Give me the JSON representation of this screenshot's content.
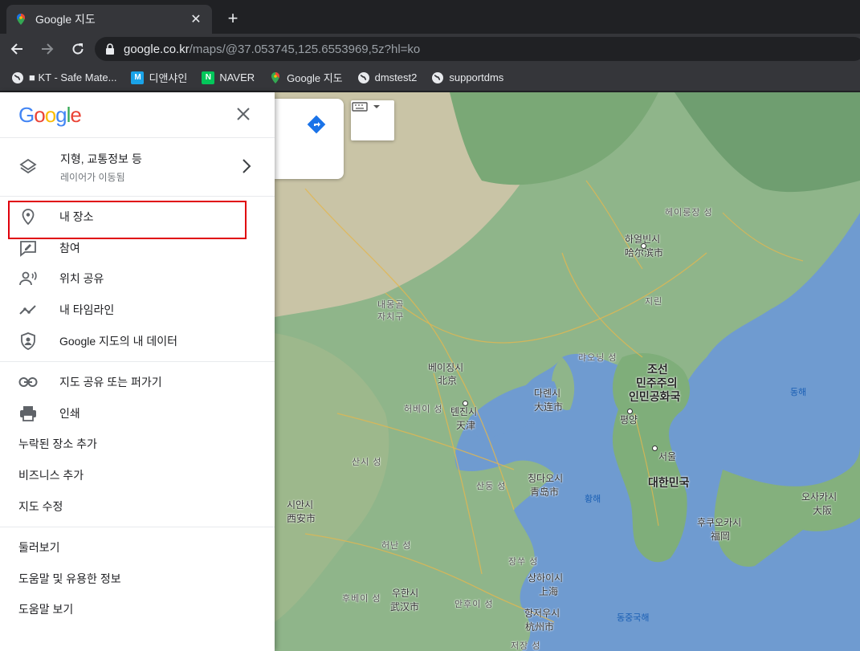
{
  "browser": {
    "tab_title": "Google 지도",
    "url_host": "google.co.kr",
    "url_path": "/maps/@37.053745,125.6553969,5z?hl=ko",
    "bookmarks": [
      {
        "label": "■ KT - Safe Mate...",
        "icon": "globe-icon"
      },
      {
        "label": "디앤샤인",
        "icon": "m-icon",
        "color": "#1aa3e8"
      },
      {
        "label": "NAVER",
        "icon": "naver-icon",
        "color": "#03c75a"
      },
      {
        "label": "Google 지도",
        "icon": "maps-pin-icon"
      },
      {
        "label": "dmstest2",
        "icon": "globe-icon"
      },
      {
        "label": "supportdms",
        "icon": "globe-icon"
      }
    ]
  },
  "panel": {
    "logo": "Google",
    "layers_title": "지형, 교통정보 등",
    "layers_subtitle": "레이어가 이동됨",
    "section1": [
      {
        "label": "내 장소",
        "icon": "pin-icon"
      },
      {
        "label": "참여",
        "icon": "contribute-icon"
      },
      {
        "label": "위치 공유",
        "icon": "location-sharing-icon"
      },
      {
        "label": "내 타임라인",
        "icon": "timeline-icon"
      },
      {
        "label": "Google 지도의 내 데이터",
        "icon": "shield-icon"
      }
    ],
    "section2": [
      {
        "label": "지도 공유 또는 퍼가기",
        "icon": "link-icon"
      },
      {
        "label": "인쇄",
        "icon": "print-icon"
      },
      {
        "label": "누락된 장소 추가"
      },
      {
        "label": "비즈니스 추가"
      },
      {
        "label": "지도 수정"
      }
    ],
    "section3": [
      {
        "label": "둘러보기"
      },
      {
        "label": "도움말 및 유용한 정보"
      },
      {
        "label": "도움말 보기"
      }
    ]
  },
  "map": {
    "labels": {
      "heilongjiang": "헤이룽장 성",
      "harbin_ko": "하얼빈시",
      "harbin_zh": "哈尔滨市",
      "jilin": "지린",
      "neimenggu1": "내몽골",
      "neimenggu2": "자치구",
      "liaoning": "랴오닝 성",
      "beijing_ko": "베이징시",
      "beijing_zh": "北京",
      "tianjin_ko": "톈진시",
      "tianjin_zh": "天津",
      "hebei": "허베이 성",
      "dalian_ko": "다롄시",
      "dalian_zh": "大连市",
      "nk1": "조선",
      "nk2": "민주주의",
      "nk3": "인민공화국",
      "pyongyang": "평양",
      "seoul": "서울",
      "sk": "대한민국",
      "eastsea": "동해",
      "yellowsea": "황해",
      "shanxi": "산시 성",
      "shandong": "산둥 성",
      "qingdao_ko": "칭다오시",
      "qingdao_zh": "青岛市",
      "xian_ko": "시안시",
      "xian_zh": "西安市",
      "henan": "허난 성",
      "jiangsu": "장쑤 성",
      "shanghai_ko": "상하이시",
      "shanghai_zh": "上海",
      "hubei": "후베이 성",
      "wuhan_ko": "우한시",
      "wuhan_zh": "武汉市",
      "anhui": "안후이 성",
      "hangzhou_ko": "항저우시",
      "hangzhou_zh": "杭州市",
      "zhejiang": "저장 성",
      "eastchinasea": "동중국해",
      "fukuoka_ko": "후쿠오카시",
      "fukuoka_ja": "福岡",
      "osaka_ko": "오사카시",
      "osaka_ja": "大阪"
    }
  }
}
